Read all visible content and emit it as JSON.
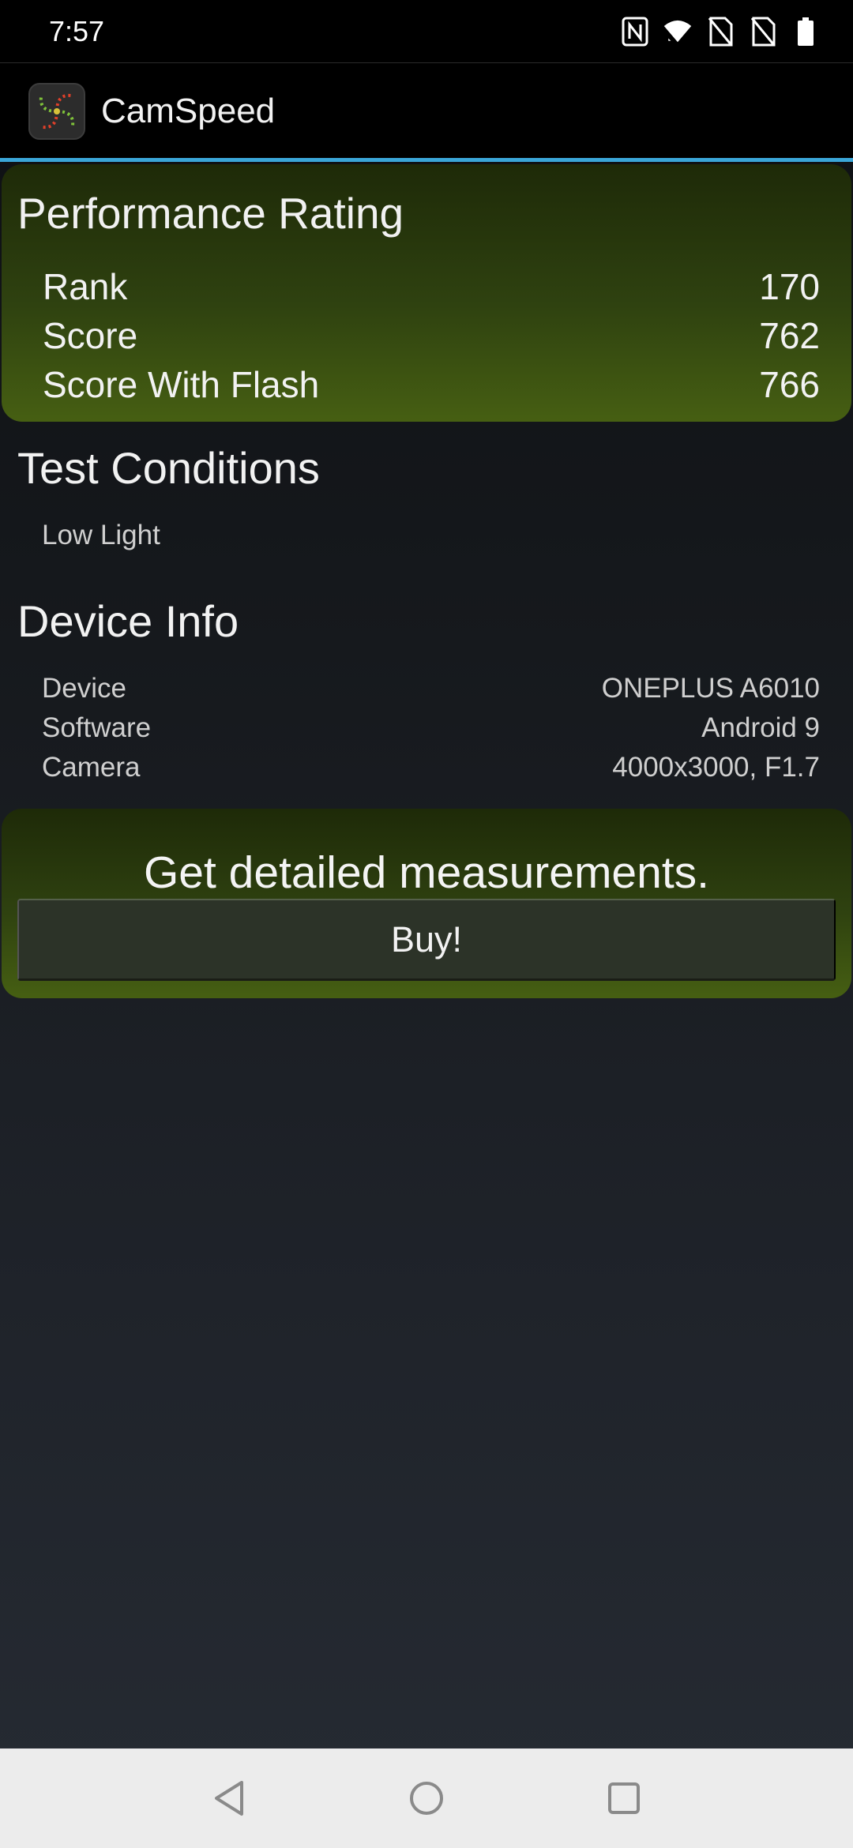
{
  "status_bar": {
    "time": "7:57",
    "icons": [
      "nfc-icon",
      "wifi-icon",
      "no-sim-icon",
      "no-sim-icon",
      "battery-icon"
    ]
  },
  "app": {
    "title": "CamSpeed",
    "accent_color": "#3aa6d8"
  },
  "performance": {
    "title": "Performance Rating",
    "rows": [
      {
        "label": "Rank",
        "value": "170"
      },
      {
        "label": "Score",
        "value": "762"
      },
      {
        "label": "Score With Flash",
        "value": "766"
      }
    ]
  },
  "test_conditions": {
    "title": "Test Conditions",
    "value": "Low Light"
  },
  "device_info": {
    "title": "Device Info",
    "rows": [
      {
        "label": "Device",
        "value": "ONEPLUS A6010"
      },
      {
        "label": "Software",
        "value": "Android 9"
      },
      {
        "label": "Camera",
        "value": "4000x3000, F1.7"
      }
    ]
  },
  "promo": {
    "title": "Get detailed measurements.",
    "button_label": "Buy!"
  },
  "nav": {
    "buttons": [
      "back-icon",
      "home-icon",
      "recents-icon"
    ]
  }
}
